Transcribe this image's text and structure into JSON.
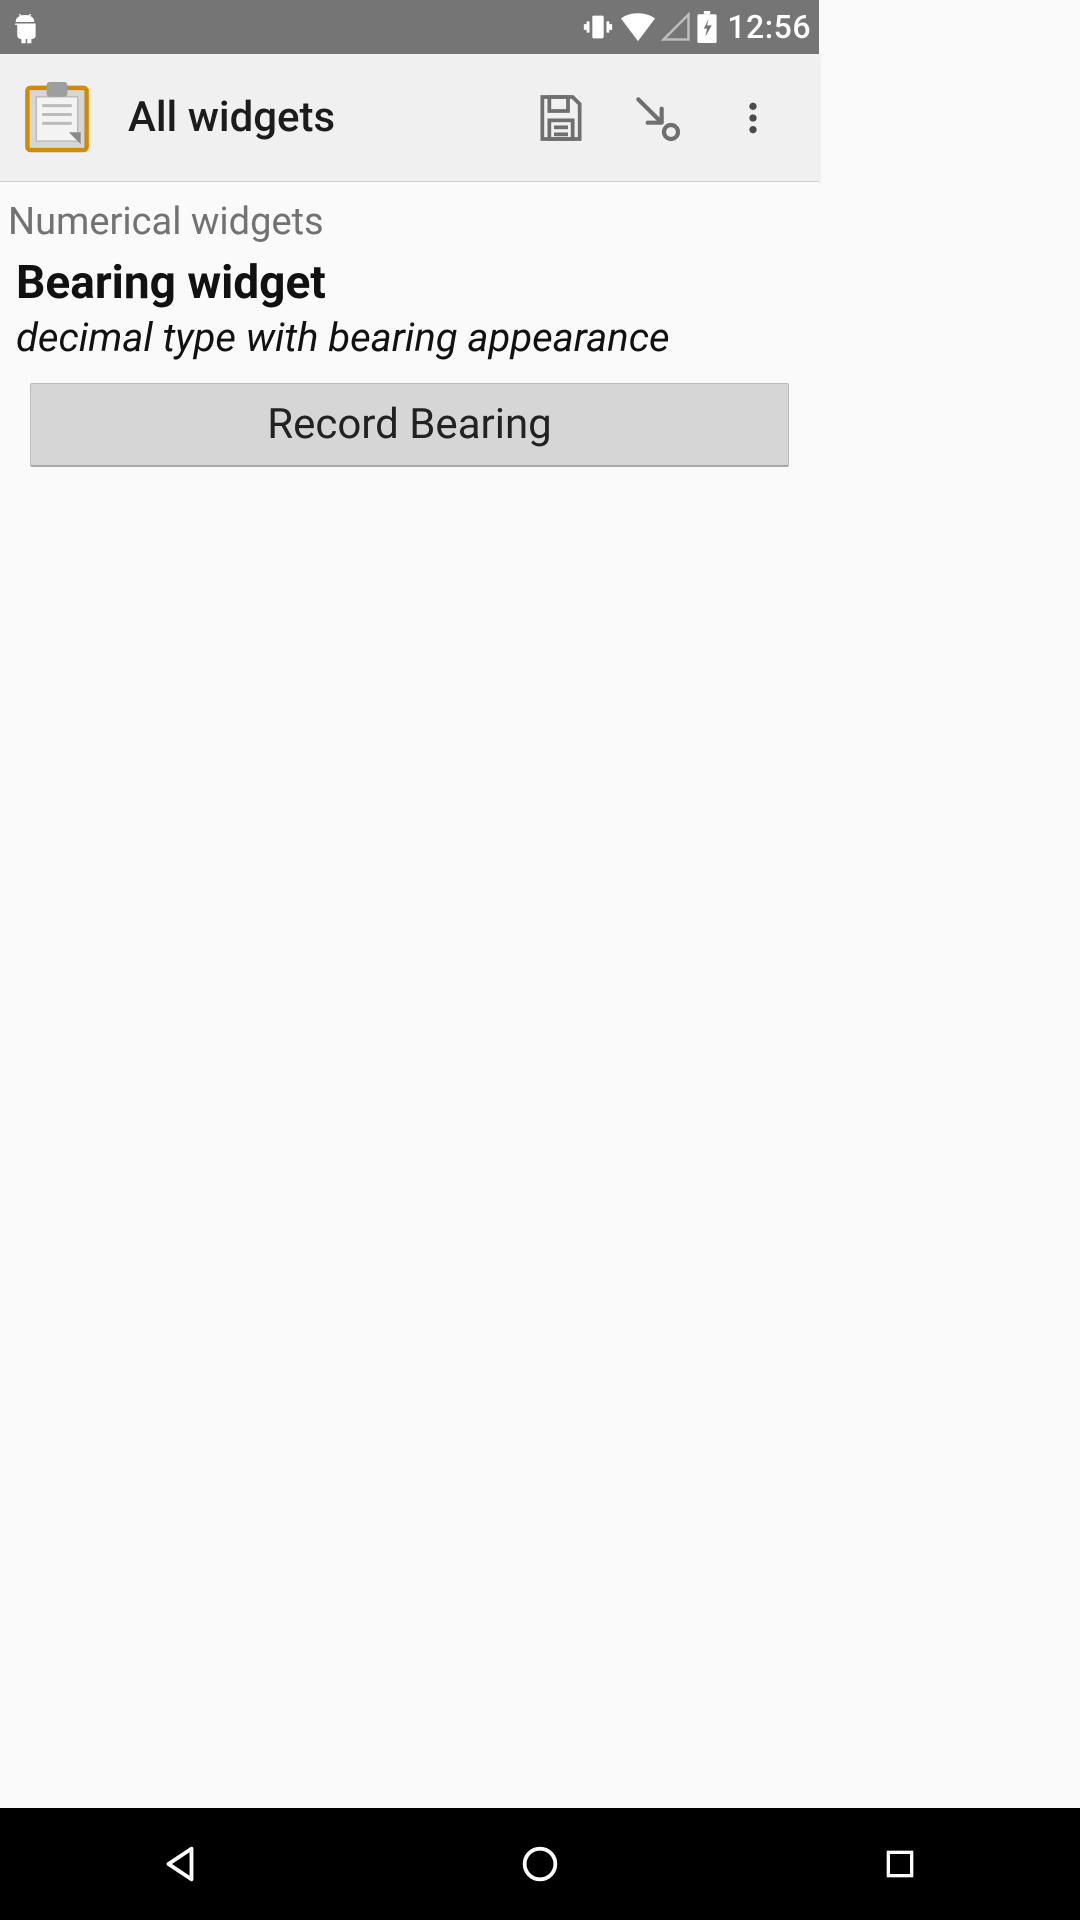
{
  "status": {
    "time": "12:56"
  },
  "appbar": {
    "title": "All widgets"
  },
  "form": {
    "group_label": "Numerical widgets",
    "question_title": "Bearing widget",
    "question_hint": "decimal type with bearing appearance",
    "button_label": "Record Bearing"
  }
}
